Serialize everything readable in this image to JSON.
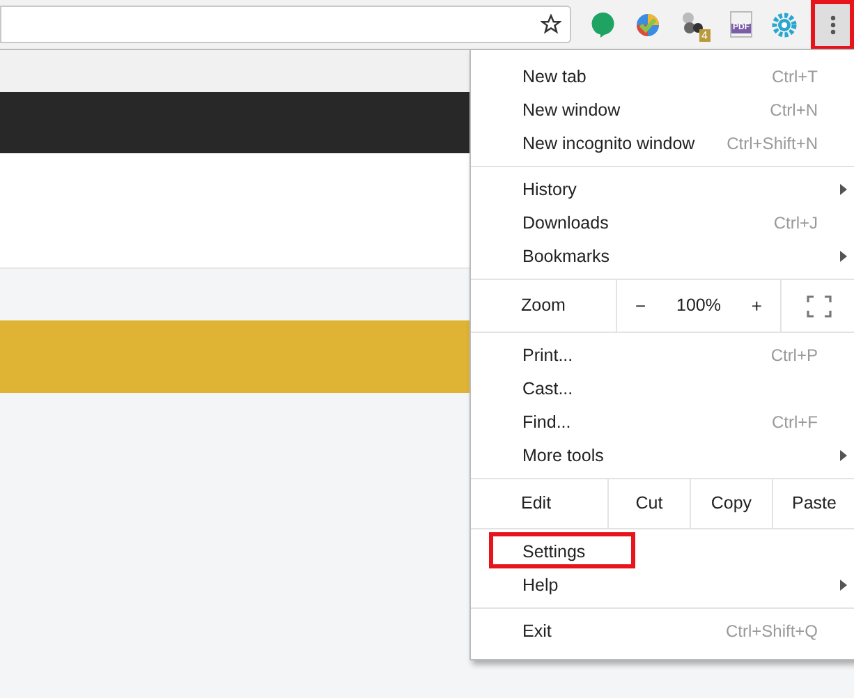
{
  "toolbar": {
    "extensions": [
      {
        "kind": "bubble"
      },
      {
        "kind": "check"
      },
      {
        "kind": "balls",
        "badge": "4"
      },
      {
        "kind": "pdf",
        "label": "PDF"
      },
      {
        "kind": "gear"
      }
    ],
    "menu_button": {
      "annotated": true
    }
  },
  "menu": {
    "sections": [
      {
        "kind": "items",
        "items": [
          {
            "label": "New tab",
            "shortcut": "Ctrl+T"
          },
          {
            "label": "New window",
            "shortcut": "Ctrl+N"
          },
          {
            "label": "New incognito window",
            "shortcut": "Ctrl+Shift+N"
          }
        ]
      },
      {
        "kind": "items",
        "items": [
          {
            "label": "History",
            "submenu": true
          },
          {
            "label": "Downloads",
            "shortcut": "Ctrl+J"
          },
          {
            "label": "Bookmarks",
            "submenu": true
          }
        ]
      },
      {
        "kind": "zoom",
        "label": "Zoom",
        "minus": "−",
        "value": "100%",
        "plus": "+"
      },
      {
        "kind": "items",
        "items": [
          {
            "label": "Print...",
            "shortcut": "Ctrl+P"
          },
          {
            "label": "Cast..."
          },
          {
            "label": "Find...",
            "shortcut": "Ctrl+F"
          },
          {
            "label": "More tools",
            "submenu": true
          }
        ]
      },
      {
        "kind": "edit",
        "label": "Edit",
        "buttons": [
          "Cut",
          "Copy",
          "Paste"
        ]
      },
      {
        "kind": "items",
        "items": [
          {
            "label": "Settings",
            "annotated": true
          },
          {
            "label": "Help",
            "submenu": true
          }
        ]
      },
      {
        "kind": "items",
        "items": [
          {
            "label": "Exit",
            "shortcut": "Ctrl+Shift+Q"
          }
        ]
      }
    ]
  }
}
